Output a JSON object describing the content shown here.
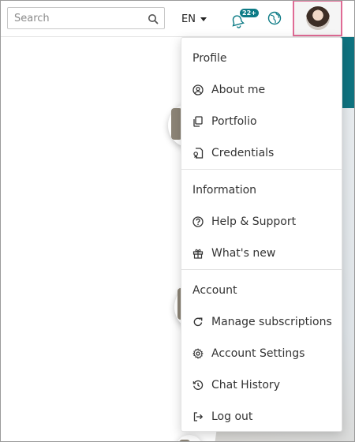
{
  "header": {
    "search_placeholder": "Search",
    "language": "EN",
    "notification_count": "22+"
  },
  "menu": {
    "sections": [
      {
        "title": "Profile",
        "items": [
          {
            "label": "About me",
            "icon": "user-circle-icon"
          },
          {
            "label": "Portfolio",
            "icon": "copy-documents-icon"
          },
          {
            "label": "Credentials",
            "icon": "certificate-icon"
          }
        ]
      },
      {
        "title": "Information",
        "items": [
          {
            "label": "Help & Support",
            "icon": "question-circle-icon"
          },
          {
            "label": "What's new",
            "icon": "gift-icon"
          }
        ]
      },
      {
        "title": "Account",
        "items": [
          {
            "label": "Manage subscriptions",
            "icon": "refresh-icon"
          },
          {
            "label": "Account Settings",
            "icon": "gear-icon"
          },
          {
            "label": "Chat History",
            "icon": "history-icon"
          },
          {
            "label": "Log out",
            "icon": "logout-icon"
          }
        ]
      }
    ]
  },
  "colors": {
    "accent_teal": "#0d7b86",
    "avatar_highlight": "#e06b95"
  }
}
